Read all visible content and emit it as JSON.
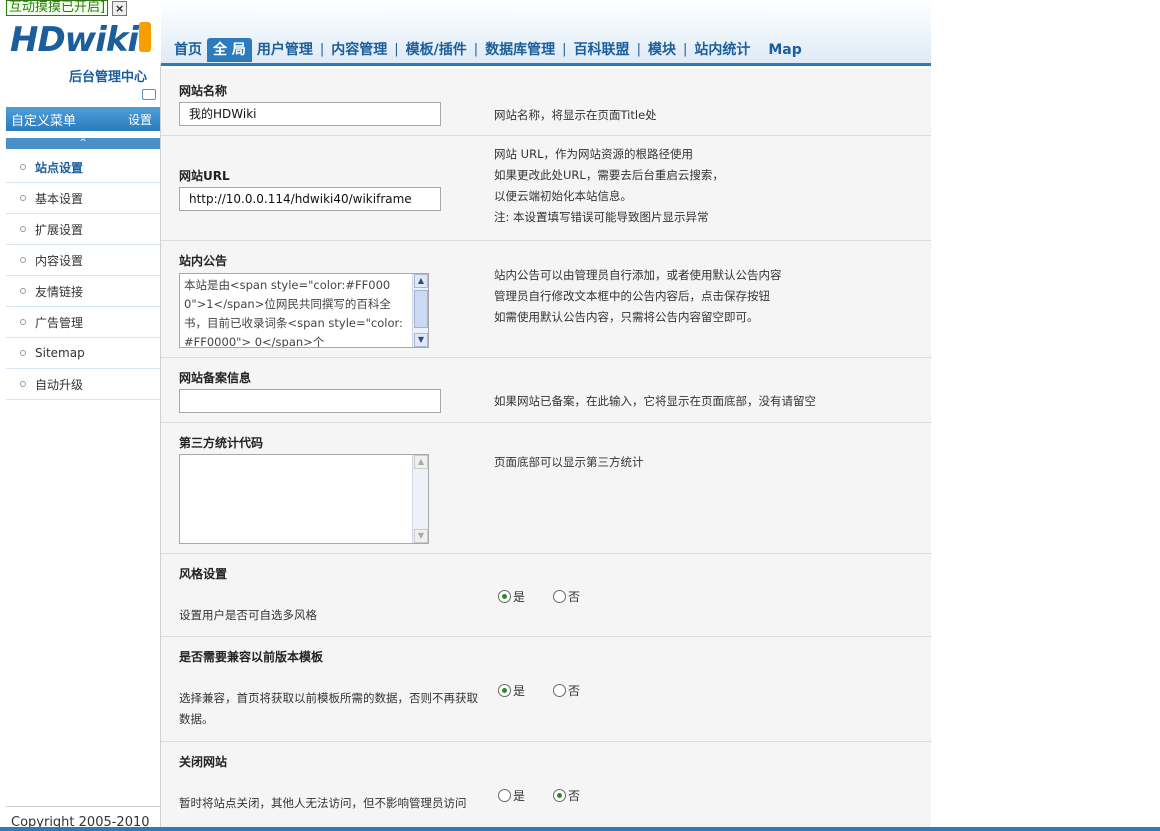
{
  "banner": {
    "text": "互动摸摸已开启]",
    "close": "×"
  },
  "logo": {
    "brand": "HDwiki",
    "subtitle": "后台管理中心"
  },
  "menu": {
    "title": "自定义菜单",
    "settings": "设置",
    "collapse": "^"
  },
  "sidebar": {
    "items": [
      {
        "label": "站点设置",
        "active": true
      },
      {
        "label": "基本设置"
      },
      {
        "label": "扩展设置"
      },
      {
        "label": "内容设置"
      },
      {
        "label": "友情链接"
      },
      {
        "label": "广告管理"
      },
      {
        "label": "Sitemap"
      },
      {
        "label": "自动升级"
      }
    ]
  },
  "copyright": "Copyright 2005-2010",
  "nav": {
    "items": [
      "首页",
      "全 局",
      "用户管理",
      "内容管理",
      "模板/插件",
      "数据库管理",
      "百科联盟",
      "模块",
      "站内统计",
      "Map"
    ],
    "separator": "|"
  },
  "form": {
    "site_name": {
      "label": "网站名称",
      "value": "我的HDWiki",
      "desc": "网站名称，将显示在页面Title处"
    },
    "site_url": {
      "label": "网站URL",
      "value": "http://10.0.0.114/hdwiki40/wikiframe",
      "desc": [
        "网站 URL，作为网站资源的根路径使用",
        "如果更改此处URL，需要去后台重启云搜索，",
        "以便云端初始化本站信息。",
        "注: 本设置填写错误可能导致图片显示异常"
      ]
    },
    "notice": {
      "label": "站内公告",
      "value": "本站是由<span style=\"color:#FF0000\">1</span>位网民共同撰写的百科全书，目前已收录词条<span style=\"color:#FF0000\"> 0</span>个",
      "desc": [
        "站内公告可以由管理员自行添加，或者使用默认公告内容",
        "管理员自行修改文本框中的公告内容后，点击保存按钮",
        "如需使用默认公告内容，只需将公告内容留空即可。"
      ]
    },
    "icp": {
      "label": "网站备案信息",
      "value": "",
      "desc": "如果网站已备案，在此输入，它将显示在页面底部，没有请留空"
    },
    "stats_code": {
      "label": "第三方统计代码",
      "value": "",
      "desc": "页面底部可以显示第三方统计"
    },
    "style": {
      "label": "风格设置",
      "help": "设置用户是否可自选多风格",
      "yes": "是",
      "no": "否",
      "selected": "yes"
    },
    "compat": {
      "label": "是否需要兼容以前版本模板",
      "help": "选择兼容，首页将获取以前模板所需的数据，否则不再获取数据。",
      "yes": "是",
      "no": "否",
      "selected": "yes"
    },
    "close_site": {
      "label": "关闭网站",
      "help": "暂时将站点关闭，其他人无法访问，但不影响管理员访问",
      "yes": "是",
      "no": "否",
      "selected": "no"
    }
  }
}
